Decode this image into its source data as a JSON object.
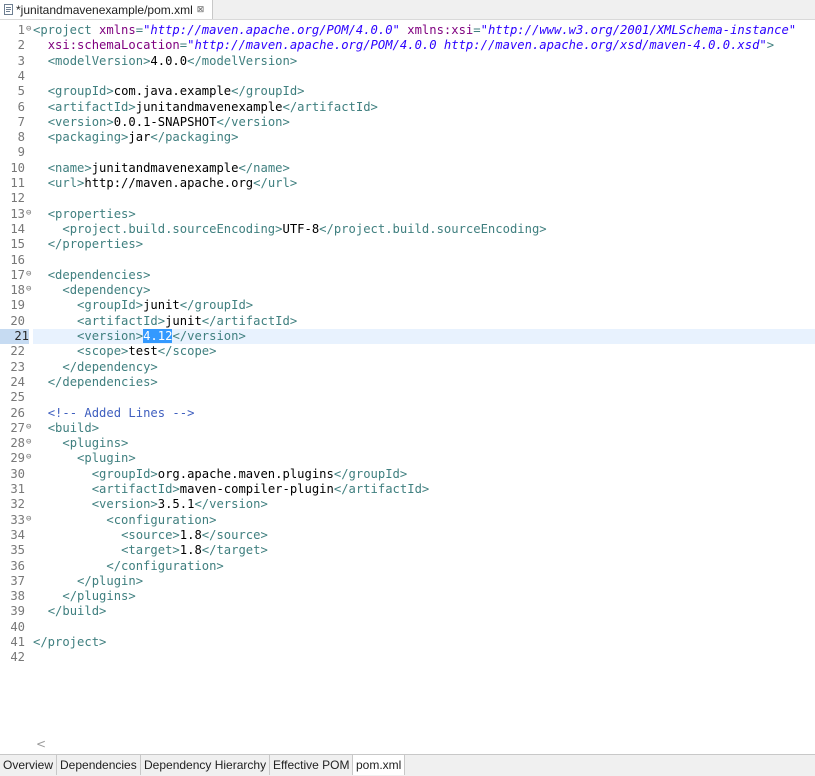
{
  "editor_tab": {
    "title": "*junitandmavenexample/pom.xml",
    "close_glyph": "⊠"
  },
  "bottom_tabs": [
    "Overview",
    "Dependencies",
    "Dependency Hierarchy",
    "Effective POM",
    "pom.xml"
  ],
  "active_bottom_tab": "pom.xml",
  "current_line": 21,
  "fold_lines": [
    1,
    13,
    17,
    18,
    27,
    28,
    29,
    33
  ],
  "colors": {
    "tag": "#3f7f7f",
    "attr": "#7f007f",
    "value": "#2a00ff",
    "comment": "#3f5fbf",
    "selection": "#3399ff",
    "current_line": "#e8f2fe"
  },
  "icons": {
    "file": "xml-file-icon",
    "scroll": "scroll-left-icon"
  },
  "lines": [
    [
      [
        "t",
        "<project "
      ],
      [
        "a",
        "xmlns"
      ],
      [
        "t",
        "="
      ],
      [
        "v",
        "\"http://maven.apache.org/POM/4.0.0\""
      ],
      [
        "x",
        " "
      ],
      [
        "a",
        "xmlns:xsi"
      ],
      [
        "t",
        "="
      ],
      [
        "v",
        "\"http://www.w3.org/2001/XMLSchema-instance\""
      ]
    ],
    [
      [
        "x",
        "  "
      ],
      [
        "a",
        "xsi:schemaLocation"
      ],
      [
        "t",
        "="
      ],
      [
        "v",
        "\"http://maven.apache.org/POM/4.0.0 http://maven.apache.org/xsd/maven-4.0.0.xsd\""
      ],
      [
        "t",
        ">"
      ]
    ],
    [
      [
        "x",
        "  "
      ],
      [
        "t",
        "<modelVersion>"
      ],
      [
        "x",
        "4.0.0"
      ],
      [
        "t",
        "</modelVersion>"
      ]
    ],
    [],
    [
      [
        "x",
        "  "
      ],
      [
        "t",
        "<groupId>"
      ],
      [
        "x",
        "com.java.example"
      ],
      [
        "t",
        "</groupId>"
      ]
    ],
    [
      [
        "x",
        "  "
      ],
      [
        "t",
        "<artifactId>"
      ],
      [
        "x",
        "junitandmavenexample"
      ],
      [
        "t",
        "</artifactId>"
      ]
    ],
    [
      [
        "x",
        "  "
      ],
      [
        "t",
        "<version>"
      ],
      [
        "x",
        "0.0.1-SNAPSHOT"
      ],
      [
        "t",
        "</version>"
      ]
    ],
    [
      [
        "x",
        "  "
      ],
      [
        "t",
        "<packaging>"
      ],
      [
        "x",
        "jar"
      ],
      [
        "t",
        "</packaging>"
      ]
    ],
    [],
    [
      [
        "x",
        "  "
      ],
      [
        "t",
        "<name>"
      ],
      [
        "x",
        "junitandmavenexample"
      ],
      [
        "t",
        "</name>"
      ]
    ],
    [
      [
        "x",
        "  "
      ],
      [
        "t",
        "<url>"
      ],
      [
        "x",
        "http://maven.apache.org"
      ],
      [
        "t",
        "</url>"
      ]
    ],
    [],
    [
      [
        "x",
        "  "
      ],
      [
        "t",
        "<properties>"
      ]
    ],
    [
      [
        "x",
        "    "
      ],
      [
        "t",
        "<project.build.sourceEncoding>"
      ],
      [
        "x",
        "UTF-8"
      ],
      [
        "t",
        "</project.build.sourceEncoding>"
      ]
    ],
    [
      [
        "x",
        "  "
      ],
      [
        "t",
        "</properties>"
      ]
    ],
    [],
    [
      [
        "x",
        "  "
      ],
      [
        "t",
        "<dependencies>"
      ]
    ],
    [
      [
        "x",
        "    "
      ],
      [
        "t",
        "<dependency>"
      ]
    ],
    [
      [
        "x",
        "      "
      ],
      [
        "t",
        "<groupId>"
      ],
      [
        "x",
        "junit"
      ],
      [
        "t",
        "</groupId>"
      ]
    ],
    [
      [
        "x",
        "      "
      ],
      [
        "t",
        "<artifactId>"
      ],
      [
        "x",
        "junit"
      ],
      [
        "t",
        "</artifactId>"
      ]
    ],
    [
      [
        "x",
        "      "
      ],
      [
        "t",
        "<version>"
      ],
      [
        "s",
        "4.12"
      ],
      [
        "t",
        "</version>"
      ]
    ],
    [
      [
        "x",
        "      "
      ],
      [
        "t",
        "<scope>"
      ],
      [
        "x",
        "test"
      ],
      [
        "t",
        "</scope>"
      ]
    ],
    [
      [
        "x",
        "    "
      ],
      [
        "t",
        "</dependency>"
      ]
    ],
    [
      [
        "x",
        "  "
      ],
      [
        "t",
        "</dependencies>"
      ]
    ],
    [],
    [
      [
        "x",
        "  "
      ],
      [
        "c",
        "<!-- Added Lines -->"
      ]
    ],
    [
      [
        "x",
        "  "
      ],
      [
        "t",
        "<build>"
      ]
    ],
    [
      [
        "x",
        "    "
      ],
      [
        "t",
        "<plugins>"
      ]
    ],
    [
      [
        "x",
        "      "
      ],
      [
        "t",
        "<plugin>"
      ]
    ],
    [
      [
        "x",
        "        "
      ],
      [
        "t",
        "<groupId>"
      ],
      [
        "x",
        "org.apache.maven.plugins"
      ],
      [
        "t",
        "</groupId>"
      ]
    ],
    [
      [
        "x",
        "        "
      ],
      [
        "t",
        "<artifactId>"
      ],
      [
        "x",
        "maven-compiler-plugin"
      ],
      [
        "t",
        "</artifactId>"
      ]
    ],
    [
      [
        "x",
        "        "
      ],
      [
        "t",
        "<version>"
      ],
      [
        "x",
        "3.5.1"
      ],
      [
        "t",
        "</version>"
      ]
    ],
    [
      [
        "x",
        "          "
      ],
      [
        "t",
        "<configuration>"
      ]
    ],
    [
      [
        "x",
        "            "
      ],
      [
        "t",
        "<source>"
      ],
      [
        "x",
        "1.8"
      ],
      [
        "t",
        "</source>"
      ]
    ],
    [
      [
        "x",
        "            "
      ],
      [
        "t",
        "<target>"
      ],
      [
        "x",
        "1.8"
      ],
      [
        "t",
        "</target>"
      ]
    ],
    [
      [
        "x",
        "          "
      ],
      [
        "t",
        "</configuration>"
      ]
    ],
    [
      [
        "x",
        "      "
      ],
      [
        "t",
        "</plugin>"
      ]
    ],
    [
      [
        "x",
        "    "
      ],
      [
        "t",
        "</plugins>"
      ]
    ],
    [
      [
        "x",
        "  "
      ],
      [
        "t",
        "</build>"
      ]
    ],
    [],
    [
      [
        "t",
        "</project>"
      ]
    ],
    []
  ]
}
